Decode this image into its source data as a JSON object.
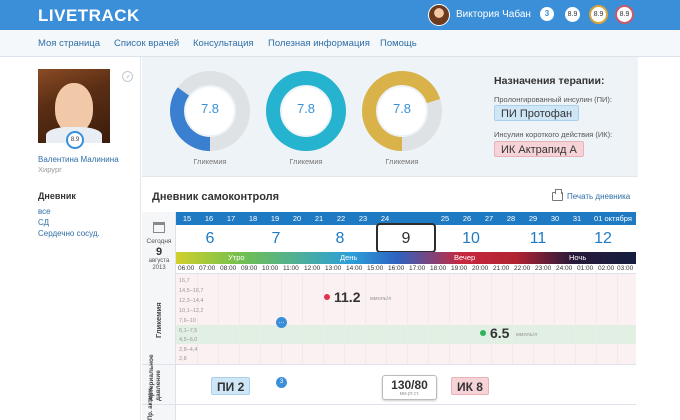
{
  "app": {
    "logo": "LIVETRACK"
  },
  "user": {
    "name": "Виктория Чабан",
    "notifications": "3",
    "score1": "8.9",
    "score2": "8.9",
    "score3": "8.9"
  },
  "nav": {
    "items": [
      "Моя страница",
      "Список врачей",
      "Консультация",
      "Полезная информация",
      "Помощь"
    ]
  },
  "doctor": {
    "name": "Валентина Малинина",
    "role": "Хирург",
    "rating": "8.9"
  },
  "diary_menu": {
    "title": "Дневник",
    "items": [
      "все",
      "СД",
      "Сердечно сосуд."
    ]
  },
  "gauges": [
    {
      "value": "7.8",
      "label": "Гликемия",
      "fill": 0.35,
      "color": "#3a7fd0"
    },
    {
      "value": "7.8",
      "label": "Гликемия",
      "fill": 1.0,
      "color": "#26b3cf"
    },
    {
      "value": "7.8",
      "label": "Гликемия",
      "fill": 0.7,
      "color": "#d9b34a"
    }
  ],
  "therapy": {
    "title": "Назначения терапии:",
    "long_label": "Пролонгированный инсулин (ПИ):",
    "long_tag": "ПИ Протофан",
    "short_label": "Инсулин короткого действия (ИК):",
    "short_tag": "ИК Актрапид А"
  },
  "diary": {
    "title": "Дневник самоконтроля",
    "print": "Печать дневника"
  },
  "calendar": {
    "today_label": "Сегодня",
    "today_day": "9",
    "today_month": "августа 2013",
    "dates": [
      "15",
      "16",
      "17",
      "18",
      "19",
      "20",
      "21",
      "22",
      "23",
      "24",
      "25",
      "26",
      "27",
      "28",
      "29",
      "30",
      "31",
      "01 октября"
    ],
    "weeks": [
      "6",
      "7",
      "8",
      "9",
      "10",
      "11",
      "12"
    ],
    "selected_week": "9",
    "dayparts": [
      "Утро",
      "День",
      "Вечер",
      "Ночь"
    ],
    "times": [
      "06:00",
      "07:00",
      "08:00",
      "09:00",
      "10:00",
      "11:00",
      "12:00",
      "13:00",
      "14:00",
      "15:00",
      "16:00",
      "17:00",
      "18:00",
      "19:00",
      "20:00",
      "21:00",
      "22:00",
      "23:00",
      "24:00",
      "01:00",
      "02:00",
      "03:00"
    ]
  },
  "glycemia": {
    "side_label": "Гликемия",
    "ticks": [
      "16,7",
      "14,5–16,7",
      "12,3–14,4",
      "10,1–12,2",
      "7,6–10",
      "6,1–7,5",
      "4,5–6,0",
      "2,8–4,4",
      "2,8"
    ],
    "reading1": {
      "value": "11.2",
      "unit": "ммоль/л",
      "color": "#e0334f"
    },
    "reading2": {
      "value": "6.5",
      "unit": "ммоль/л",
      "color": "#2fb35a"
    },
    "comment_icon": "chat-bubble-icon"
  },
  "pressure": {
    "side_label": "Артериальное давление",
    "pi_chip": "ПИ 2",
    "bp_value": "130/80",
    "bp_unit": "мм.рт.ст.",
    "ik_chip": "ИК 8",
    "comment_count": "3"
  },
  "bottom": {
    "side_label": "Пр. активн."
  }
}
